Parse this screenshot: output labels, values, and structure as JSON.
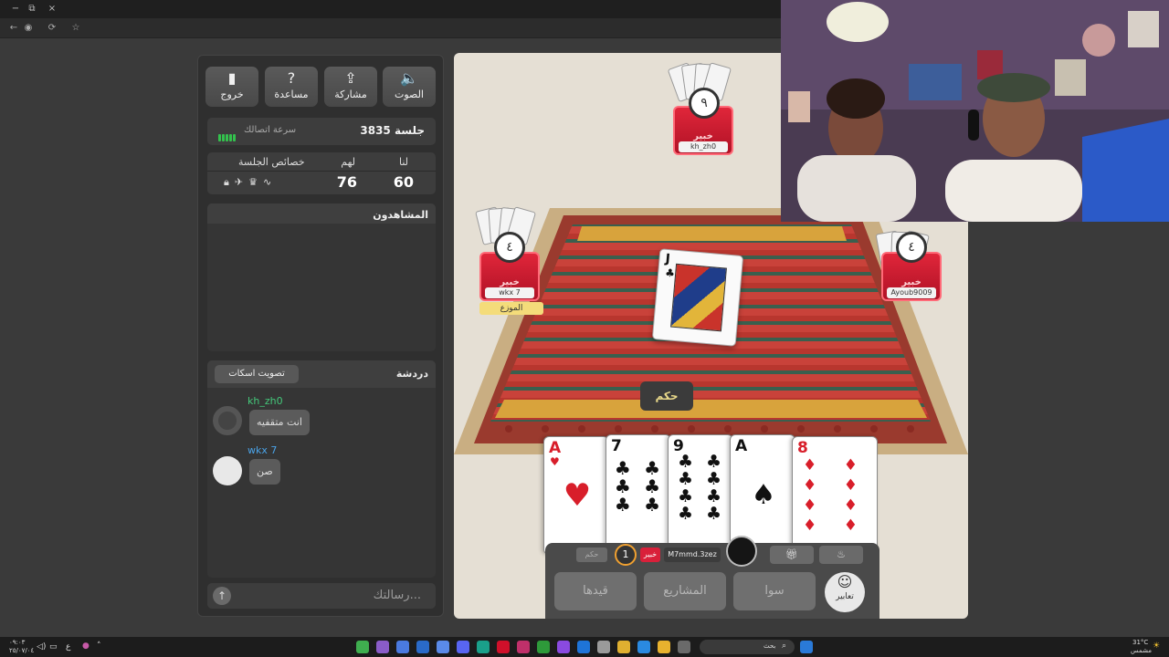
{
  "browser": {
    "window_controls": [
      "−",
      "⧉",
      "×"
    ]
  },
  "panel": {
    "top_buttons": [
      {
        "label": "خروج",
        "icon": "exit-icon",
        "glyph": "▮"
      },
      {
        "label": "مساعدة",
        "icon": "help-icon",
        "glyph": "?"
      },
      {
        "label": "مشاركة",
        "icon": "share-icon",
        "glyph": "⇪"
      },
      {
        "label": "الصوت",
        "icon": "speaker-mute-icon",
        "glyph": "🔈"
      }
    ],
    "session_title": "جلسة 3835",
    "connection_speed_label": "سرعة اتصالك",
    "scores": {
      "ours_label": "لنا",
      "ours_value": "60",
      "theirs_label": "لهم",
      "theirs_value": "76",
      "properties_label": "خصائص الجلسة"
    },
    "viewers_title": "المشاهدون",
    "chat": {
      "title": "دردشة",
      "mute_vote_label": "تصويت اسكات",
      "messages": [
        {
          "user": "kh_zh0",
          "text": "انت متقفيه",
          "user_color": "#44c87a"
        },
        {
          "user": "wkx 7",
          "text": "صن",
          "user_color": "#4aa3e8"
        }
      ],
      "input_placeholder": "رسالتك..."
    }
  },
  "game": {
    "players": {
      "top": {
        "name": "kh_zh0",
        "status": "خبير",
        "timer": "٩"
      },
      "left": {
        "name": "wkx 7",
        "status": "خبير",
        "timer": "٤",
        "dealer_label": "الموزع"
      },
      "right": {
        "name": "Ayoub9009",
        "status": "خبير",
        "timer": "٤"
      }
    },
    "center_card": {
      "rank": "J",
      "suit": "♣"
    },
    "bid_label": "حكم",
    "hand": [
      {
        "rank": "A",
        "suit": "♥",
        "color": "#d81e2a"
      },
      {
        "rank": "7",
        "suit": "♣",
        "color": "#111111"
      },
      {
        "rank": "9",
        "suit": "♣",
        "color": "#111111"
      },
      {
        "rank": "A",
        "suit": "♠",
        "color": "#111111"
      },
      {
        "rank": "8",
        "suit": "♦",
        "color": "#d81e2a"
      }
    ],
    "me": {
      "name": "M7mmd.3zez",
      "status": "خبير",
      "bid": "حكم",
      "badge": "1"
    },
    "actions": {
      "qaydha": "قيدها",
      "projects": "المشاريع",
      "sawa": "سوا",
      "expressions": "تعابير"
    }
  },
  "taskbar": {
    "search_label": "بحث",
    "weather": "31°C",
    "weather_desc": "مشمس",
    "time": "٠٩:٠٣",
    "date": "٢٥/٠٧/٠٤",
    "lang": "ع"
  }
}
